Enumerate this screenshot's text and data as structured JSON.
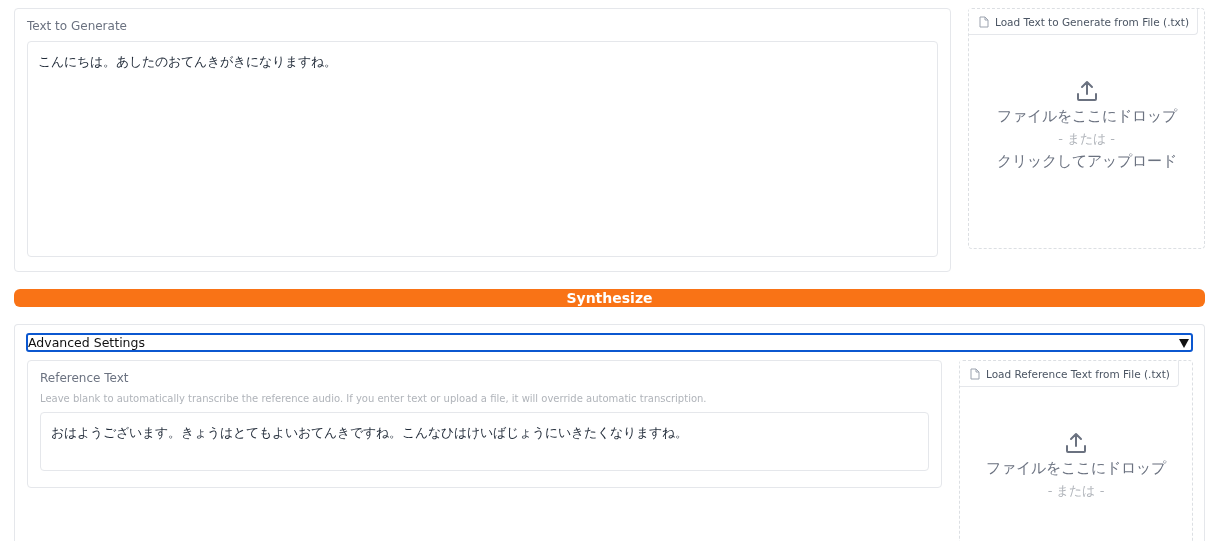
{
  "text_to_generate": {
    "label": "Text to Generate",
    "value": "こんにちは。あしたのおてんきがきになりますね。"
  },
  "text_upload": {
    "button": "Load Text to Generate from File (.txt)",
    "drop": "ファイルをここにドロップ",
    "or": "- または -",
    "click": "クリックしてアップロード"
  },
  "synthesize_button": "Synthesize",
  "advanced_settings": {
    "title": "Advanced Settings",
    "expanded": true,
    "reference_text": {
      "label": "Reference Text",
      "info": "Leave blank to automatically transcribe the reference audio. If you enter text or upload a file, it will override automatic transcription.",
      "value": "おはようございます。きょうはとてもよいおてんきですね。こんなひはけいばじょうにいきたくなりますね。"
    },
    "reference_upload": {
      "button": "Load Reference Text from File (.txt)",
      "drop": "ファイルをここにドロップ",
      "or": "- または -"
    }
  }
}
